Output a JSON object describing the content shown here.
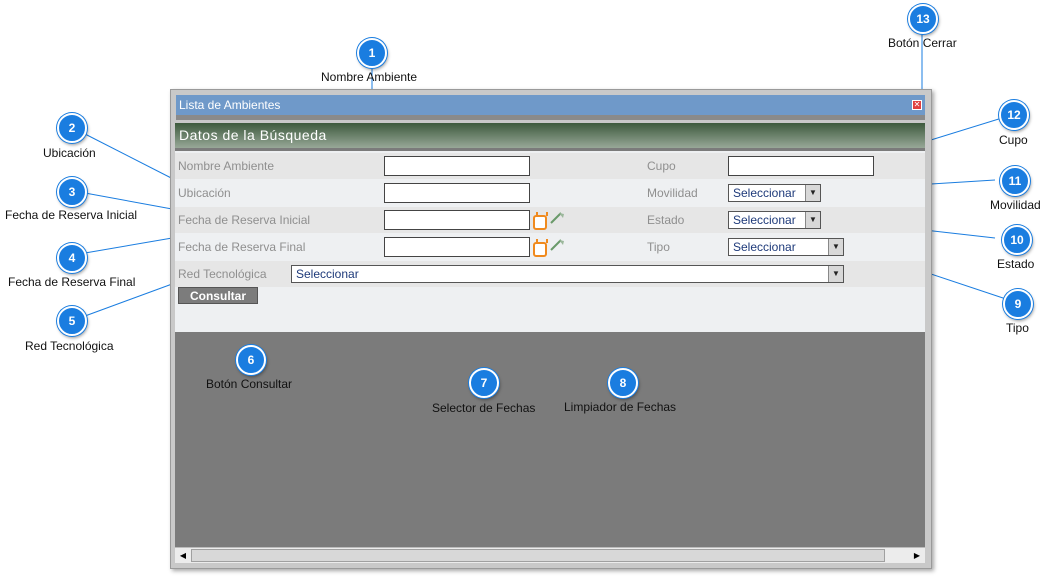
{
  "window": {
    "title": "Lista de Ambientes",
    "section_title": "Datos de la Búsqueda"
  },
  "form": {
    "nombre_ambiente_label": "Nombre Ambiente",
    "ubicacion_label": "Ubicación",
    "fecha_inicial_label": "Fecha de Reserva Inicial",
    "fecha_final_label": "Fecha de Reserva Final",
    "red_tecnologica_label": "Red Tecnológica",
    "cupo_label": "Cupo",
    "movilidad_label": "Movilidad",
    "estado_label": "Estado",
    "tipo_label": "Tipo",
    "movilidad_value": "Seleccionar",
    "estado_value": "Seleccionar",
    "tipo_value": "Seleccionar",
    "red_tecnologica_value": "Seleccionar",
    "consultar_label": "Consultar"
  },
  "annotations": [
    {
      "n": "1",
      "label": "Nombre Ambiente"
    },
    {
      "n": "2",
      "label": "Ubicación"
    },
    {
      "n": "3",
      "label": "Fecha de Reserva Inicial"
    },
    {
      "n": "4",
      "label": "Fecha de Reserva Final"
    },
    {
      "n": "5",
      "label": "Red Tecnológica"
    },
    {
      "n": "6",
      "label": "Botón Consultar"
    },
    {
      "n": "7",
      "label": "Selector de Fechas"
    },
    {
      "n": "8",
      "label": "Limpiador de Fechas"
    },
    {
      "n": "9",
      "label": "Tipo"
    },
    {
      "n": "10",
      "label": "Estado"
    },
    {
      "n": "11",
      "label": "Movilidad"
    },
    {
      "n": "12",
      "label": "Cupo"
    },
    {
      "n": "13",
      "label": "Botón Cerrar"
    }
  ],
  "colors": {
    "badge": "#1a7de0",
    "titlebar": "#6f99c9",
    "calendar_icon": "#f08a1e"
  }
}
